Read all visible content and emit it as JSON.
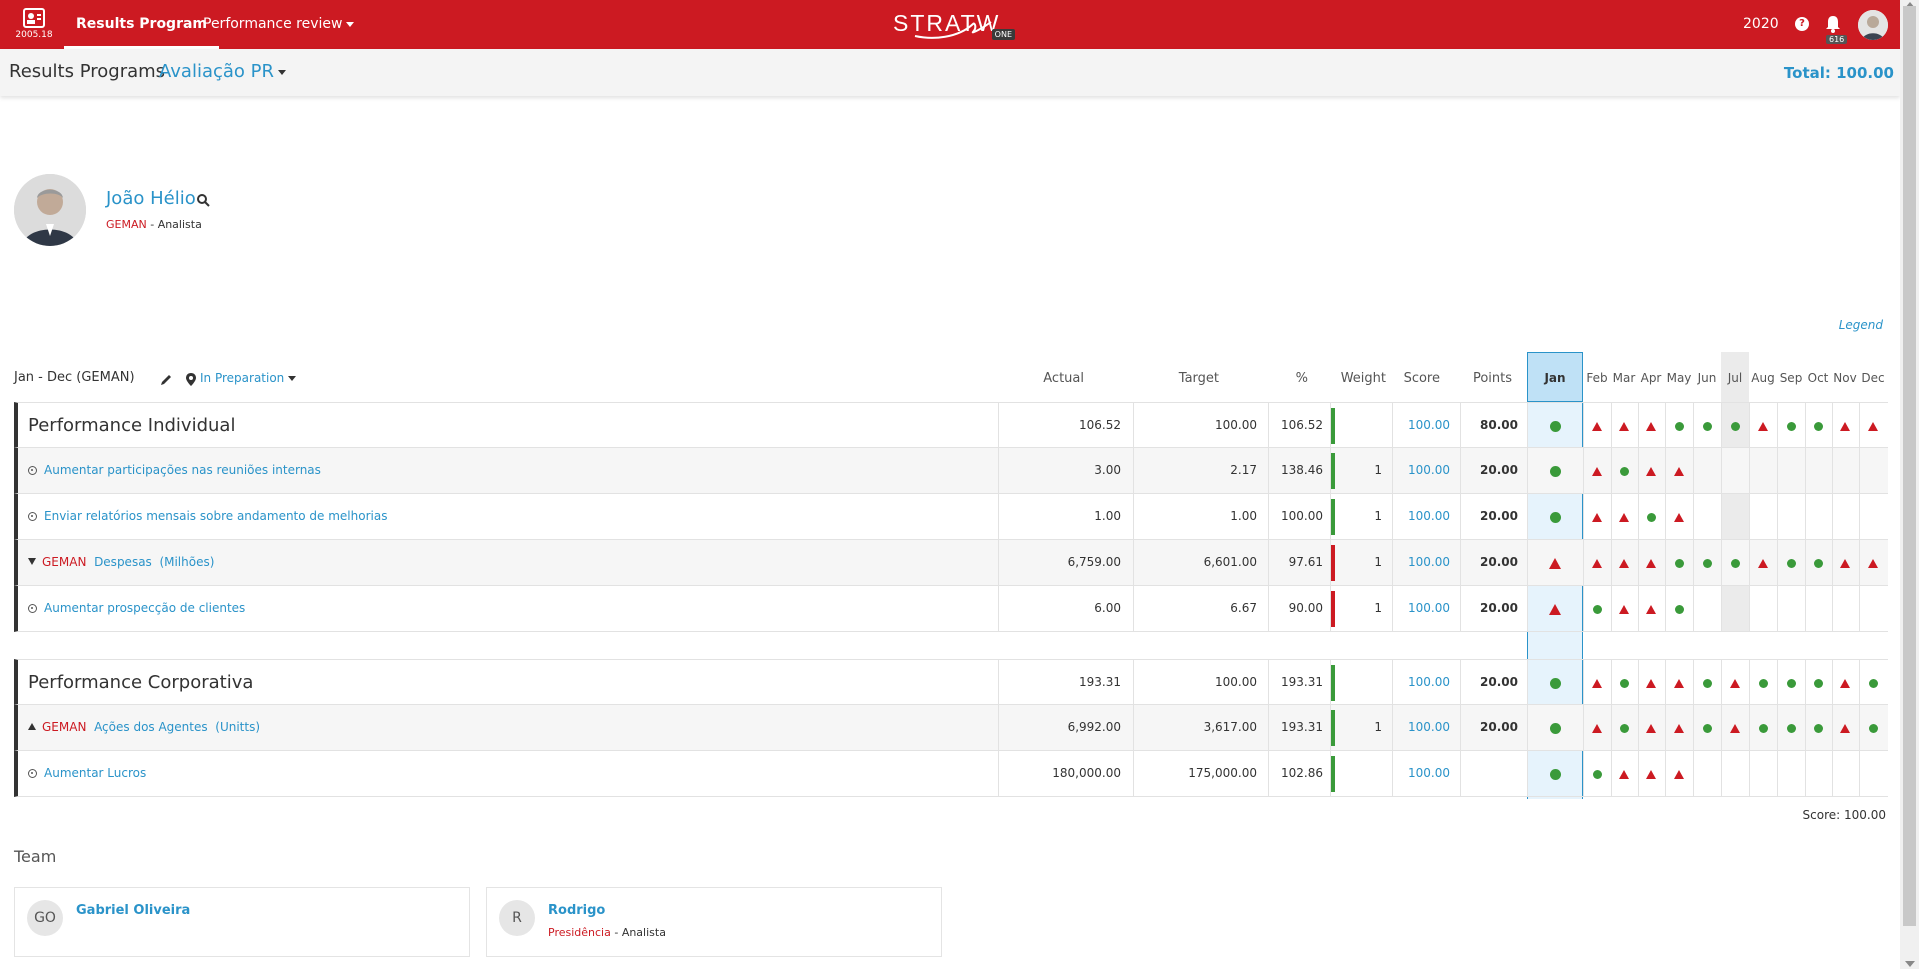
{
  "topbar": {
    "version": "2005.18",
    "nav_results": "Results Program",
    "nav_review": "Performance review",
    "logo": "STRATW",
    "logo_badge": "ONE",
    "year": "2020",
    "help": "?",
    "notifications": "616"
  },
  "subheader": {
    "title": "Results Programs",
    "program": "Avaliação PR",
    "total": "Total: 100.00"
  },
  "profile": {
    "name": "João Hélio",
    "unit": "GEMAN",
    "separator": " - ",
    "role": "Analista"
  },
  "legend": "Legend",
  "table": {
    "period": "Jan - Dec (GEMAN)",
    "status": "In Preparation",
    "columns": {
      "actual": "Actual",
      "target": "Target",
      "pct": "%",
      "weight": "Weight",
      "score": "Score",
      "points": "Points"
    },
    "months": [
      "Jan",
      "Feb",
      "Mar",
      "Apr",
      "May",
      "Jun",
      "Jul",
      "Aug",
      "Sep",
      "Oct",
      "Nov",
      "Dec"
    ],
    "groups": [
      {
        "rows": [
          {
            "kind": "group",
            "title": "Performance Individual",
            "actual": "106.52",
            "target": "100.00",
            "pct": "106.52",
            "bar": "green",
            "weight": "",
            "score": "100.00",
            "points": "80.00",
            "marks": [
              "dot",
              "tri",
              "tri",
              "tri",
              "dot",
              "dot",
              "dot",
              "tri",
              "dot",
              "dot",
              "tri",
              "tri"
            ]
          },
          {
            "kind": "item",
            "title": "Aumentar participações nas reuniões internas",
            "actual": "3.00",
            "target": "2.17",
            "pct": "138.46",
            "bar": "green",
            "weight": "1",
            "score": "100.00",
            "points": "20.00",
            "marks": [
              "dot",
              "tri",
              "dot",
              "tri",
              "tri"
            ]
          },
          {
            "kind": "item",
            "title": "Enviar relatórios mensais sobre andamento de melhorias",
            "actual": "1.00",
            "target": "1.00",
            "pct": "100.00",
            "bar": "green",
            "weight": "1",
            "score": "100.00",
            "points": "20.00",
            "marks": [
              "dot",
              "tri",
              "tri",
              "dot",
              "tri"
            ]
          },
          {
            "kind": "indicator",
            "toggle": "down",
            "unit": "GEMAN",
            "title": "Despesas",
            "suffix": "(Milhões)",
            "actual": "6,759.00",
            "target": "6,601.00",
            "pct": "97.61",
            "bar": "red",
            "weight": "1",
            "score": "100.00",
            "points": "20.00",
            "marks": [
              "tri",
              "tri",
              "tri",
              "tri",
              "dot",
              "dot",
              "dot",
              "tri",
              "dot",
              "dot",
              "tri",
              "tri"
            ]
          },
          {
            "kind": "item",
            "title": "Aumentar prospecção de clientes",
            "actual": "6.00",
            "target": "6.67",
            "pct": "90.00",
            "bar": "red",
            "weight": "1",
            "score": "100.00",
            "points": "20.00",
            "marks": [
              "tri",
              "dot",
              "tri",
              "tri",
              "dot"
            ]
          }
        ]
      },
      {
        "rows": [
          {
            "kind": "group",
            "title": "Performance Corporativa",
            "actual": "193.31",
            "target": "100.00",
            "pct": "193.31",
            "bar": "green",
            "weight": "",
            "score": "100.00",
            "points": "20.00",
            "marks": [
              "dot",
              "tri",
              "dot",
              "tri",
              "tri",
              "dot",
              "tri",
              "dot",
              "dot",
              "dot",
              "tri",
              "dot"
            ]
          },
          {
            "kind": "indicator",
            "toggle": "up",
            "unit": "GEMAN",
            "title": "Ações dos Agentes",
            "suffix": "(Unitts)",
            "actual": "6,992.00",
            "target": "3,617.00",
            "pct": "193.31",
            "bar": "green",
            "weight": "1",
            "score": "100.00",
            "points": "20.00",
            "marks": [
              "dot",
              "tri",
              "dot",
              "tri",
              "tri",
              "dot",
              "tri",
              "dot",
              "dot",
              "dot",
              "tri",
              "dot"
            ]
          },
          {
            "kind": "item",
            "title": "Aumentar Lucros",
            "actual": "180,000.00",
            "target": "175,000.00",
            "pct": "102.86",
            "bar": "green",
            "weight": "",
            "score": "100.00",
            "points": "",
            "marks": [
              "dot",
              "dot",
              "tri",
              "tri",
              "tri"
            ]
          }
        ]
      }
    ],
    "score_footer": "Score: 100.00"
  },
  "team": {
    "title": "Team",
    "members": [
      {
        "initials": "GO",
        "name": "Gabriel Oliveira",
        "unit": "",
        "role": ""
      },
      {
        "initials": "R",
        "name": "Rodrigo",
        "unit": "Presidência",
        "role": "Analista"
      }
    ]
  },
  "colors": {
    "brand": "#cc1a22",
    "link": "#2a93c9",
    "good": "#3a9a3a",
    "bad": "#cc1a22"
  }
}
